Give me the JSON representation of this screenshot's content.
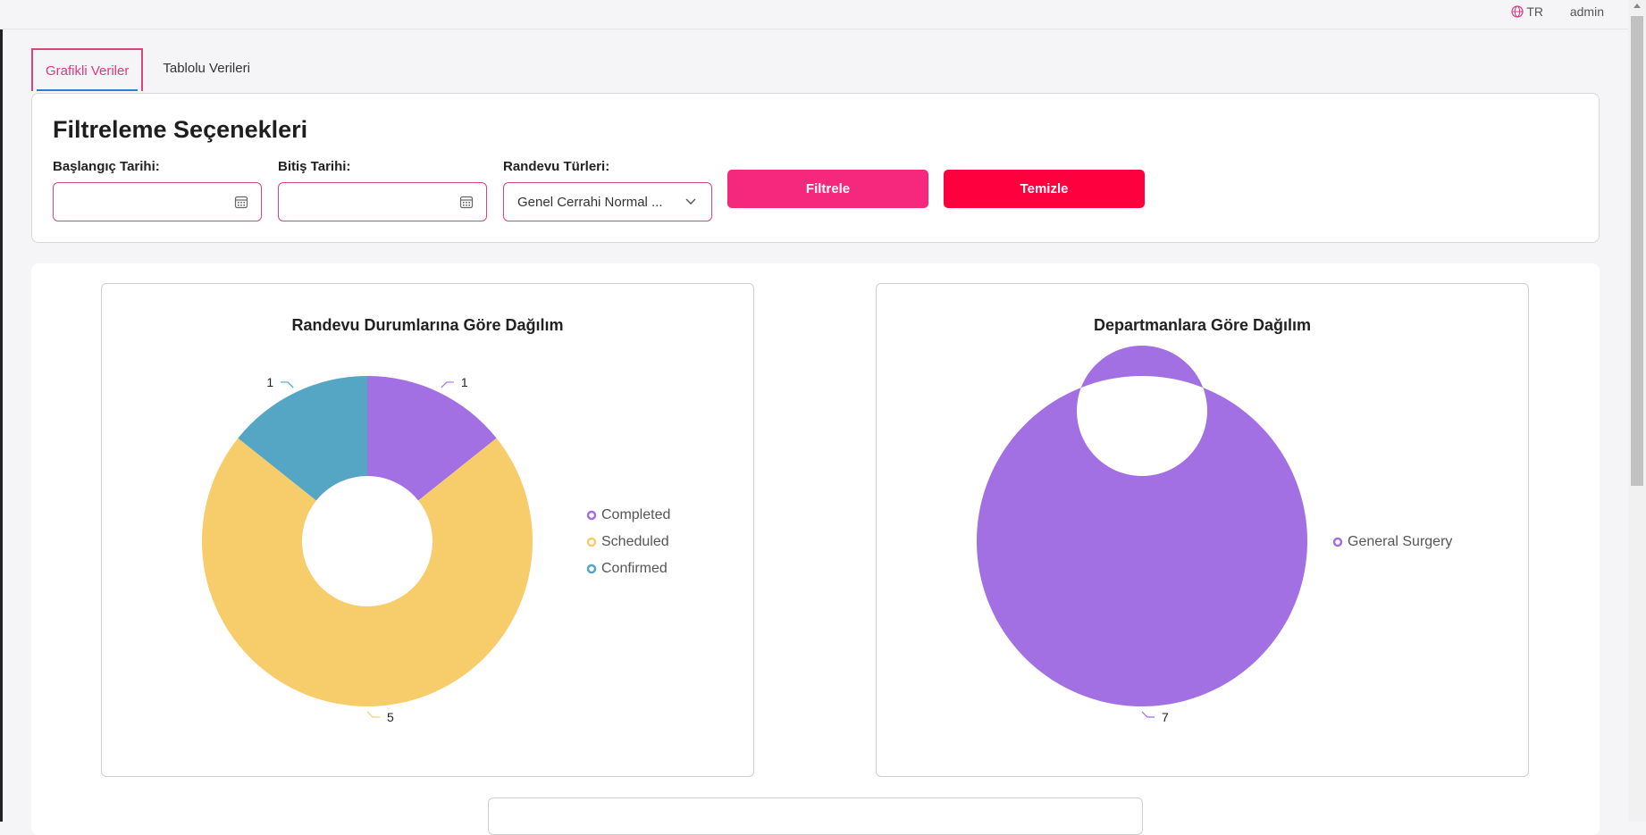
{
  "header": {
    "language": "TR",
    "user": "admin"
  },
  "tabs": [
    {
      "label": "Grafikli Veriler",
      "active": true
    },
    {
      "label": "Tablolu Verileri",
      "active": false
    }
  ],
  "filters": {
    "title": "Filtreleme Seçenekleri",
    "start_date_label": "Başlangıç Tarihi:",
    "start_date_value": "",
    "end_date_label": "Bitiş Tarihi:",
    "end_date_value": "",
    "type_label": "Randevu Türleri:",
    "type_value": "Genel Cerrahi Normal ...",
    "filter_button": "Filtrele",
    "clear_button": "Temizle"
  },
  "colors": {
    "accent": "#d6457e",
    "filter_btn": "#f5287e",
    "clear_btn": "#ff003f"
  },
  "chart_data": [
    {
      "type": "pie",
      "title": "Randevu Durumlarına Göre Dağılım",
      "series": [
        {
          "name": "Completed",
          "value": 1,
          "color": "#a270e3"
        },
        {
          "name": "Scheduled",
          "value": 5,
          "color": "#f7cd6b"
        },
        {
          "name": "Confirmed",
          "value": 1,
          "color": "#55a5c5"
        }
      ],
      "legend_position": "right"
    },
    {
      "type": "pie",
      "title": "Departmanlara Göre Dağılım",
      "series": [
        {
          "name": "General Surgery",
          "value": 7,
          "color": "#a270e3"
        }
      ],
      "legend_position": "right"
    }
  ]
}
